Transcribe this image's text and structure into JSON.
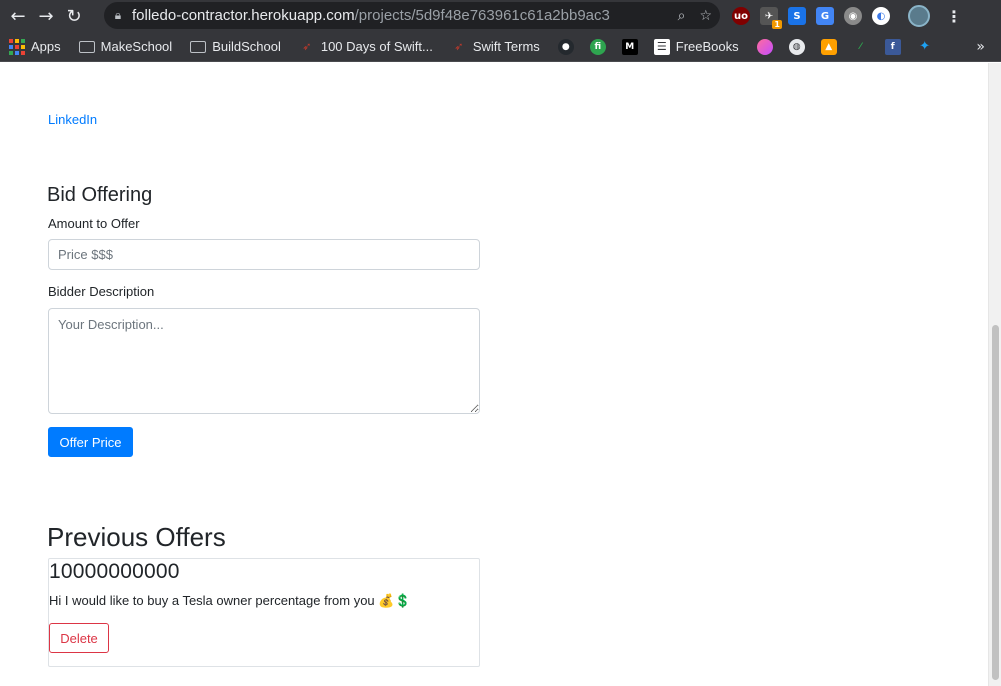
{
  "browser": {
    "url_host": "folledo-contractor.herokuapp.com",
    "url_path": "/projects/5d9f48e763961c61a2bb9ac3",
    "bookmarks": [
      {
        "label": "Apps",
        "icon": "apps-grid-icon"
      },
      {
        "label": "MakeSchool",
        "icon": "folder-icon"
      },
      {
        "label": "BuildSchool",
        "icon": "folder-icon"
      },
      {
        "label": "100 Days of Swift...",
        "icon": "swift-icon"
      },
      {
        "label": "Swift Terms",
        "icon": "swift-icon"
      },
      {
        "label": "FreeBooks",
        "icon": "book-icon"
      }
    ],
    "extension_badge": "1"
  },
  "page": {
    "linkedin_link": "LinkedIn",
    "bid_heading": "Bid Offering",
    "amount_label": "Amount to Offer",
    "amount_placeholder": "Price $$$",
    "description_label": "Bidder Description",
    "description_placeholder": "Your Description...",
    "offer_button": "Offer Price",
    "previous_heading": "Previous Offers",
    "offers": [
      {
        "amount": "10000000000",
        "description": "Hi I would like to buy a Tesla owner percentage from you 💰💲",
        "delete_label": "Delete"
      }
    ]
  },
  "colors": {
    "primary": "#007bff",
    "danger": "#dc3545",
    "chrome_bg": "#35363a"
  }
}
